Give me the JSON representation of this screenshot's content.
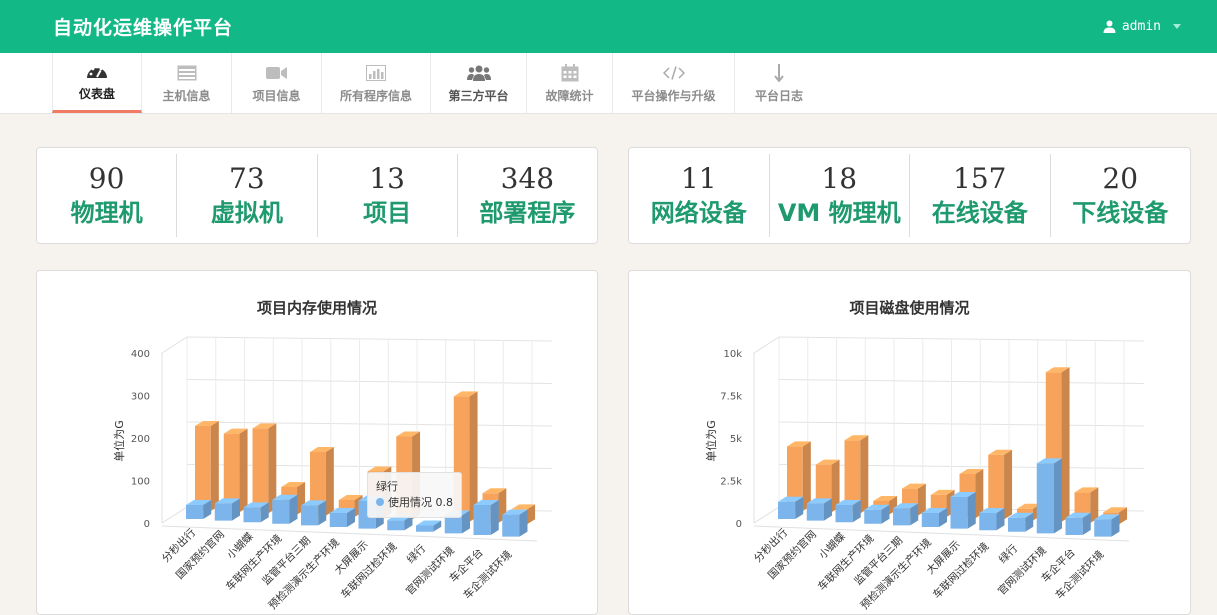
{
  "header": {
    "title": "自动化运维操作平台",
    "user": "admin"
  },
  "nav": [
    {
      "label": "仪表盘",
      "icon": "dashboard-icon"
    },
    {
      "label": "主机信息",
      "icon": "server-list-icon"
    },
    {
      "label": "项目信息",
      "icon": "video-camera-icon"
    },
    {
      "label": "所有程序信息",
      "icon": "bar-chart-icon"
    },
    {
      "label": "第三方平台",
      "icon": "users-group-icon"
    },
    {
      "label": "故障统计",
      "icon": "calendar-icon"
    },
    {
      "label": "平台操作与升级",
      "icon": "code-icon"
    },
    {
      "label": "平台日志",
      "icon": "arrow-down-icon"
    }
  ],
  "stats_left": [
    {
      "value": "90",
      "label": "物理机"
    },
    {
      "value": "73",
      "label": "虚拟机"
    },
    {
      "value": "13",
      "label": "项目"
    },
    {
      "value": "348",
      "label": "部署程序"
    }
  ],
  "stats_right": [
    {
      "value": "11",
      "label": "网络设备"
    },
    {
      "value": "18",
      "label": "VM 物理机"
    },
    {
      "value": "157",
      "label": "在线设备"
    },
    {
      "value": "20",
      "label": "下线设备"
    }
  ],
  "colors": {
    "primary": "#12b886",
    "accent": "#1e9a6e",
    "series_blue": "#7cb5ec",
    "series_orange": "#f7a35c"
  },
  "chart_data": [
    {
      "type": "bar",
      "title": "项目内存使用情况",
      "ylabel": "单位为G",
      "ylim": [
        0,
        400
      ],
      "yticks": [
        "0",
        "100",
        "200",
        "300",
        "400"
      ],
      "categories": [
        "分秒出行",
        "国家预约官网",
        "小蝴蝶",
        "车联网生产环境",
        "监管平台三期",
        "预检测演示生产环境",
        "大屏展示",
        "车联网过检环境",
        "绿行",
        "官网测试环境",
        "车企平台",
        "车企测试环境"
      ],
      "series": [
        {
          "values": [
            20,
            28,
            22,
            45,
            35,
            20,
            55,
            10,
            0.8,
            30,
            60,
            40
          ]
        },
        {
          "values": [
            200,
            185,
            200,
            65,
            150,
            40,
            110,
            195,
            0,
            295,
            70,
            35
          ]
        }
      ],
      "tooltip": {
        "category": "绿行",
        "series": "使用情况",
        "value": "0.8"
      }
    },
    {
      "type": "bar",
      "title": "项目磁盘使用情况",
      "ylabel": "单位为G",
      "ylim": [
        0,
        10000
      ],
      "yticks": [
        "0",
        "2.5k",
        "5k",
        "7.5k",
        "10k"
      ],
      "categories": [
        "分秒出行",
        "国家预约官网",
        "小蝴蝶",
        "车联网生产环境",
        "监管平台三期",
        "预检测演示生产环境",
        "大屏展示",
        "车联网过检环境",
        "绿行",
        "官网测试环境",
        "车企平台",
        "车企测试环境"
      ],
      "series": [
        {
          "values": [
            700,
            700,
            700,
            500,
            700,
            500,
            1600,
            700,
            500,
            4000,
            700,
            700
          ]
        },
        {
          "values": [
            3800,
            2800,
            4300,
            800,
            1600,
            1300,
            2600,
            3800,
            700,
            8800,
            1800,
            700
          ]
        }
      ]
    }
  ]
}
